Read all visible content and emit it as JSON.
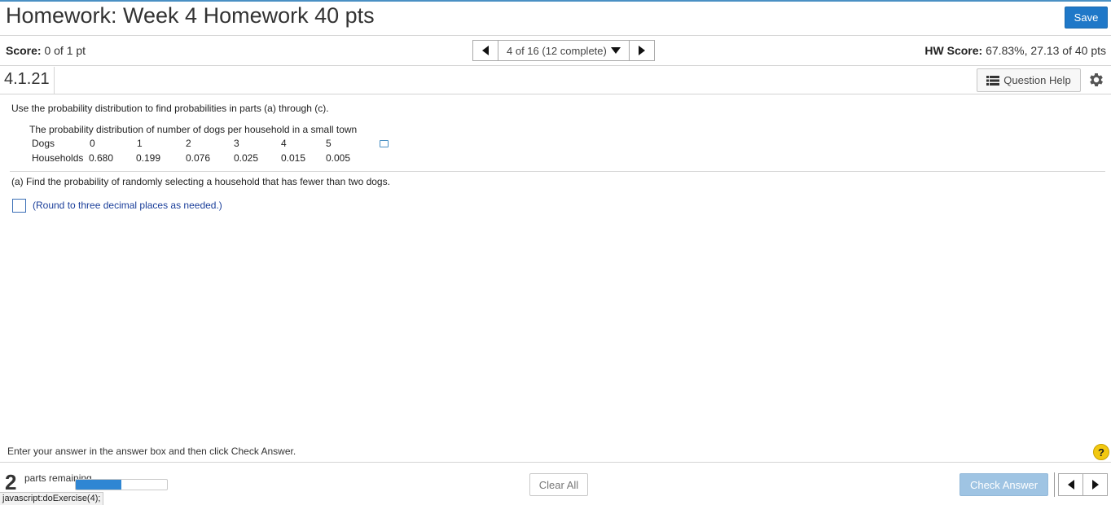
{
  "header": {
    "title": "Homework: Week 4 Homework 40 pts",
    "save_label": "Save"
  },
  "score_bar": {
    "score_label": "Score:",
    "score_value": "0 of 1 pt",
    "nav_text": "4 of 16 (12 complete)",
    "hw_score_label": "HW Score:",
    "hw_score_value": "67.83%, 27.13 of 40 pts"
  },
  "question": {
    "number": "4.1.21",
    "help_label": "Question Help"
  },
  "content": {
    "instructions": "Use the probability distribution to find probabilities in parts (a) through (c).",
    "table_title": "The probability distribution of number of dogs per household in a small town",
    "table": {
      "row1_label": "Dogs",
      "dogs": [
        "0",
        "1",
        "2",
        "3",
        "4",
        "5"
      ],
      "row2_label": "Households",
      "households": [
        "0.680",
        "0.199",
        "0.076",
        "0.025",
        "0.015",
        "0.005"
      ]
    },
    "part_a": "(a) Find the probability of randomly selecting a household that has fewer than two dogs.",
    "answer_value": "",
    "round_hint": "(Round to three decimal places as needed.)"
  },
  "footer": {
    "enter_hint": "Enter your answer in the answer box and then click Check Answer.",
    "help_glyph": "?",
    "parts_remaining_num": "2",
    "parts_remaining_label": "parts remaining",
    "progress_fraction": 0.5,
    "clear_all_label": "Clear All",
    "check_answer_label": "Check Answer",
    "status_text": "javascript:doExercise(4);"
  },
  "colors": {
    "save_button": "#1f78c8",
    "check_answer_button": "#9fc4e3",
    "progress_fill": "#2f86d3",
    "help_icon": "#f2c811",
    "hint_text": "#1a3e9a"
  },
  "icons": {
    "nav_prev": "triangle-left-icon",
    "nav_next": "triangle-right-icon",
    "nav_dropdown": "triangle-down-icon",
    "question_help": "list-icon",
    "settings": "gear-icon",
    "popout": "popout-icon",
    "help": "question-circle-icon"
  }
}
